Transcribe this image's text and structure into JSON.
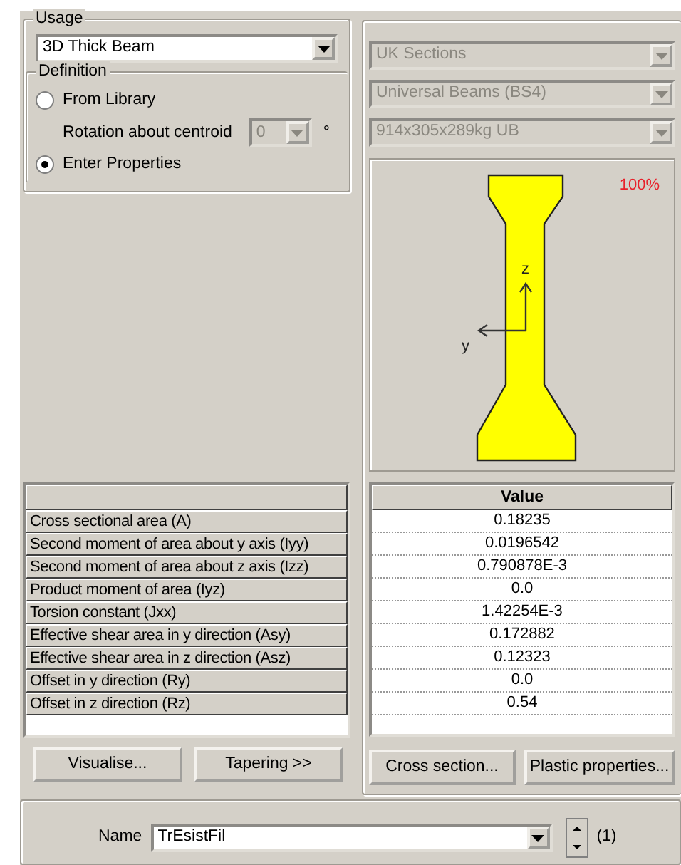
{
  "usage": {
    "legend": "Usage",
    "value": "3D Thick Beam"
  },
  "definition": {
    "legend": "Definition",
    "options": [
      {
        "label": "From Library",
        "selected": false
      },
      {
        "label": "Enter Properties",
        "selected": true
      }
    ],
    "rotation": {
      "label": "Rotation about centroid",
      "value": "0",
      "disabled": true,
      "unit": "°"
    }
  },
  "library": [
    {
      "value": "UK Sections",
      "disabled": true
    },
    {
      "value": "Universal Beams (BS4)",
      "disabled": true
    },
    {
      "value": "914x305x289kg UB",
      "disabled": true
    }
  ],
  "preview": {
    "zoom": "100%",
    "axis_z": "z",
    "axis_y": "y"
  },
  "properties": {
    "value_header": "Value",
    "rows": [
      {
        "label": "Cross sectional area (A)",
        "value": "0.18235"
      },
      {
        "label": "Second moment of area about y axis (Iyy)",
        "value": "0.0196542"
      },
      {
        "label": "Second moment of area about z axis (Izz)",
        "value": "0.790878E-3"
      },
      {
        "label": "Product moment of area (Iyz)",
        "value": "0.0"
      },
      {
        "label": "Torsion constant (Jxx)",
        "value": "1.42254E-3"
      },
      {
        "label": "Effective shear area in y direction (Asy)",
        "value": "0.172882"
      },
      {
        "label": "Effective shear area in z direction (Asz)",
        "value": "0.12323"
      },
      {
        "label": "Offset in y direction (Ry)",
        "value": "0.0"
      },
      {
        "label": "Offset in z direction (Rz)",
        "value": "0.54"
      }
    ]
  },
  "buttons": [
    "Visualise...",
    "Tapering >>",
    "Cross section...",
    "Plastic properties..."
  ],
  "name": {
    "label": "Name",
    "value": "TrEsistFil",
    "count": "(1)"
  }
}
